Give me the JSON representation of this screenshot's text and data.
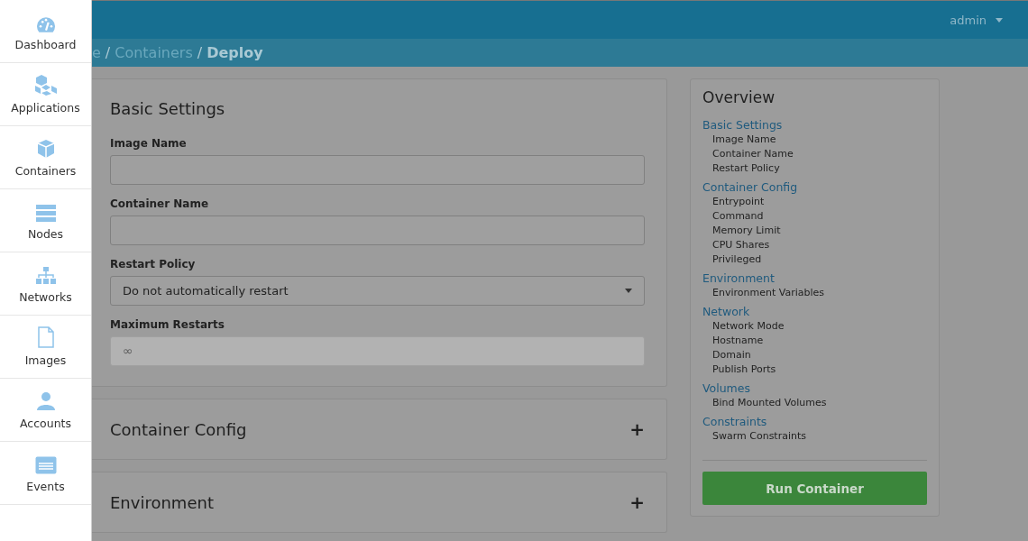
{
  "sidebar": {
    "items": [
      {
        "label": "Dashboard"
      },
      {
        "label": "Applications"
      },
      {
        "label": "Containers"
      },
      {
        "label": "Nodes"
      },
      {
        "label": "Networks"
      },
      {
        "label": "Images"
      },
      {
        "label": "Accounts"
      },
      {
        "label": "Events"
      }
    ]
  },
  "topbar": {
    "user": "admin"
  },
  "breadcrumb": [
    {
      "label": "e",
      "current": false
    },
    {
      "separator": "/"
    },
    {
      "label": "Containers",
      "current": false
    },
    {
      "separator": "/"
    },
    {
      "label": "Deploy",
      "current": true
    }
  ],
  "sections": [
    {
      "title": "Basic Settings",
      "expanded": true,
      "fields": [
        {
          "label": "Image Name",
          "kind": "text",
          "disabled": false
        },
        {
          "label": "Container Name",
          "kind": "text",
          "disabled": false
        },
        {
          "label": "Restart Policy",
          "kind": "select",
          "value": "Do not automatically restart"
        },
        {
          "label": "Maximum Restarts",
          "kind": "text",
          "placeholder": "∞",
          "disabled": true
        }
      ]
    },
    {
      "title": "Container Config",
      "expanded": false,
      "toggle": "+"
    },
    {
      "title": "Environment",
      "expanded": false,
      "toggle": "+"
    }
  ],
  "overview": {
    "title": "Overview",
    "groups": [
      {
        "title": "Basic Settings",
        "items": [
          "Image Name",
          "Container Name",
          "Restart Policy"
        ]
      },
      {
        "title": "Container Config",
        "items": [
          "Entrypoint",
          "Command",
          "Memory Limit",
          "CPU Shares",
          "Privileged"
        ]
      },
      {
        "title": "Environment",
        "items": [
          "Environment Variables"
        ]
      },
      {
        "title": "Network",
        "items": [
          "Network Mode",
          "Hostname",
          "Domain",
          "Publish Ports"
        ]
      },
      {
        "title": "Volumes",
        "items": [
          "Bind Mounted Volumes"
        ]
      },
      {
        "title": "Constraints",
        "items": [
          "Swarm Constraints"
        ]
      }
    ],
    "button": "Run Container"
  }
}
